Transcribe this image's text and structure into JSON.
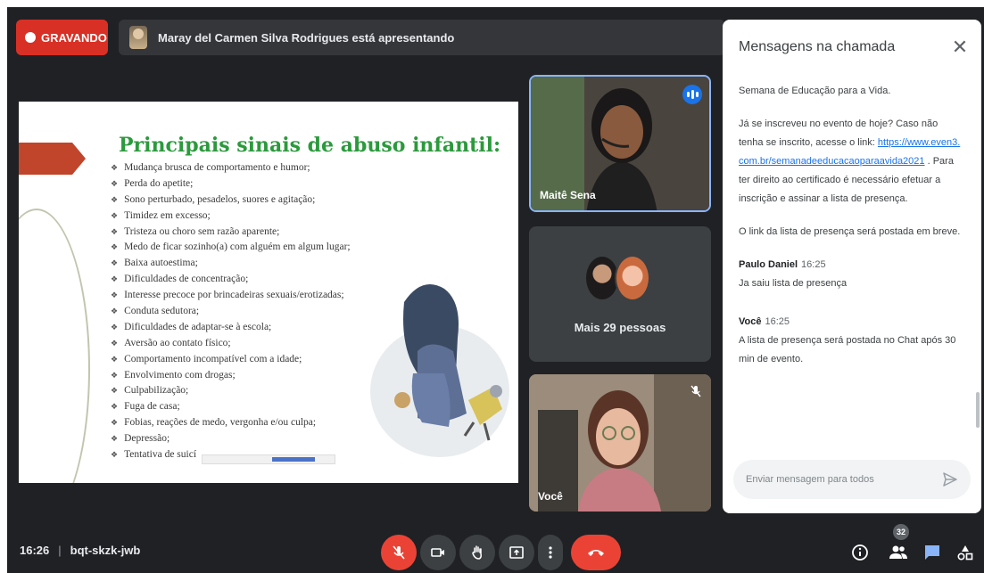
{
  "recording": {
    "label": "GRAVANDO"
  },
  "presenting": {
    "text": "Maray del Carmen Silva Rodrigues está apresentando"
  },
  "slide": {
    "title": "Principais sinais de abuso infantil:",
    "items": [
      "Mudança brusca de comportamento e humor;",
      "Perda do apetite;",
      "Sono perturbado, pesadelos, suores e agitação;",
      "Timidez em excesso;",
      "Tristeza ou choro sem razão aparente;",
      "Medo de ficar sozinho(a) com alguém em algum lugar;",
      "Baixa autoestima;",
      "Dificuldades de concentração;",
      "Interesse precoce por brincadeiras sexuais/erotizadas;",
      "Conduta sedutora;",
      "Dificuldades de adaptar-se à escola;",
      "Aversão ao contato físico;",
      "Comportamento incompatível com a idade;",
      "Envolvimento com drogas;",
      "Culpabilização;",
      "Fuga de casa;",
      "Fobias, reações de medo, vergonha e/ou culpa;",
      "Depressão;",
      "Tentativa de suicí"
    ]
  },
  "participants": {
    "tile1_name": "Maitê Sena",
    "tile2_label": "Mais 29 pessoas",
    "tile3_name": "Você"
  },
  "chat": {
    "title": "Mensagens na chamada",
    "system_1": "Semana de Educação para a Vida.",
    "system_2_a": "Já se inscreveu no evento de hoje? Caso não tenha se inscrito, acesse o link:",
    "system_2_link": "https://www.even3.com.br/semanadeeducacaoparaavida2021",
    "system_2_b": ". Para ter direito ao certificado é necessário efetuar a inscrição e assinar a lista de presença.",
    "system_3": "O link da lista de presença será postada em breve.",
    "messages": [
      {
        "sender": "Paulo Daniel",
        "time": "16:25",
        "text": "Ja saiu lista de presença"
      },
      {
        "sender": "Você",
        "time": "16:25",
        "text": "A lista de presença será postada no Chat após 30 min de evento."
      }
    ],
    "input_placeholder": "Enviar mensagem para todos"
  },
  "bottom": {
    "time": "16:26",
    "separator": "|",
    "meeting_code": "bqt-skzk-jwb",
    "participants_count": "32"
  },
  "colors": {
    "accent": "#1a73e8",
    "danger": "#ea4335",
    "background": "#202124"
  }
}
